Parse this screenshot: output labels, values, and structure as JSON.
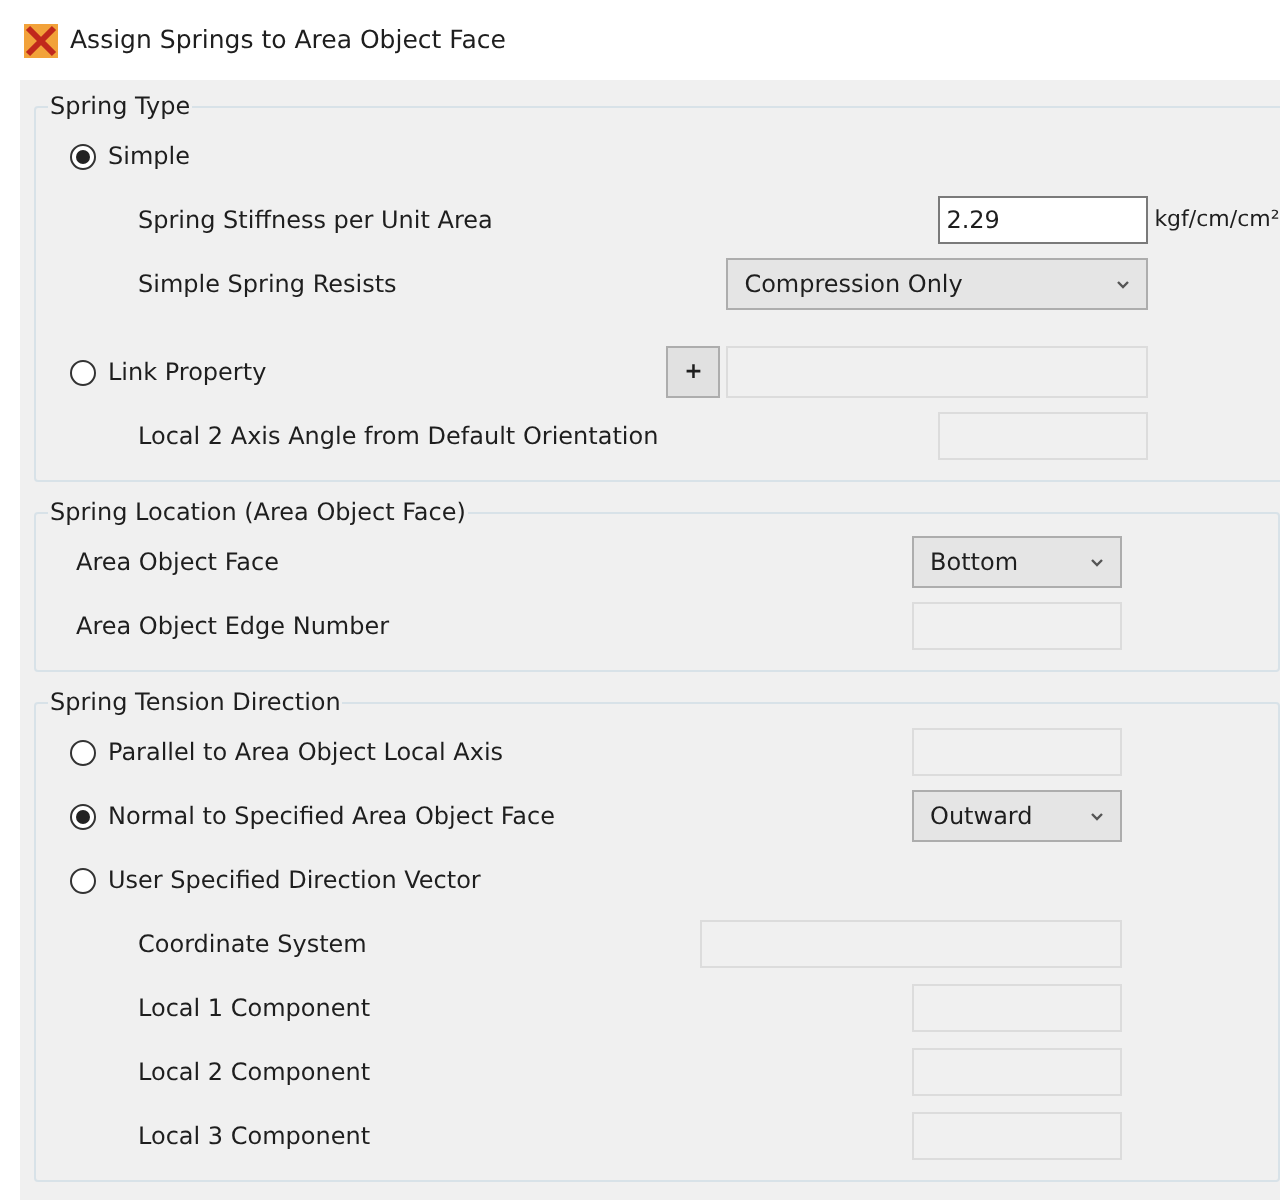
{
  "window": {
    "title": "Assign Springs to Area Object Face"
  },
  "groups": [
    {
      "title": "Spring Type",
      "rows": [
        {
          "kind": "radio",
          "label": "Simple",
          "selected": true,
          "children": [
            {
              "kind": "label",
              "label": "Spring Stiffness per Unit Area",
              "field": {
                "kind": "text",
                "value": "2.29",
                "unit": "kgf/cm/cm²",
                "disabled": false
              }
            },
            {
              "kind": "label",
              "label": "Simple Spring Resists",
              "field": {
                "kind": "wide_dropdown",
                "value": "Compression Only"
              }
            }
          ]
        },
        {
          "kind": "radio",
          "label": "Link Property",
          "selected": false,
          "field": {
            "kind": "picker",
            "button": "+",
            "disabled": true
          },
          "children": [
            {
              "kind": "label",
              "label": "Local 2 Axis Angle from Default Orientation",
              "field": {
                "kind": "text",
                "disabled": true
              }
            }
          ]
        }
      ]
    },
    {
      "title": "Spring Location (Area Object Face)",
      "rows": [
        {
          "kind": "label",
          "label": "Area Object Face",
          "field": {
            "kind": "dropdown",
            "value": "Bottom"
          }
        },
        {
          "kind": "label",
          "label": "Area Object Edge Number",
          "field": {
            "kind": "text",
            "disabled": true
          }
        }
      ]
    },
    {
      "title": "Spring Tension Direction",
      "rows": [
        {
          "kind": "radio",
          "label": "Parallel to Area Object Local Axis",
          "selected": false,
          "field": {
            "kind": "text",
            "disabled": true
          }
        },
        {
          "kind": "radio",
          "label": "Normal to Specified Area Object Face",
          "selected": true,
          "field": {
            "kind": "dropdown",
            "value": "Outward"
          }
        },
        {
          "kind": "radio",
          "label": "User Specified Direction Vector",
          "selected": false,
          "children": [
            {
              "kind": "label",
              "label": "Coordinate System",
              "field": {
                "kind": "wide_text",
                "disabled": true
              }
            },
            {
              "kind": "label",
              "label": "Local 1 Component",
              "field": {
                "kind": "text",
                "disabled": true
              }
            },
            {
              "kind": "label",
              "label": "Local 2 Component",
              "field": {
                "kind": "text",
                "disabled": true
              }
            },
            {
              "kind": "label",
              "label": "Local 3 Component",
              "field": {
                "kind": "text",
                "disabled": true
              }
            }
          ]
        }
      ]
    }
  ]
}
